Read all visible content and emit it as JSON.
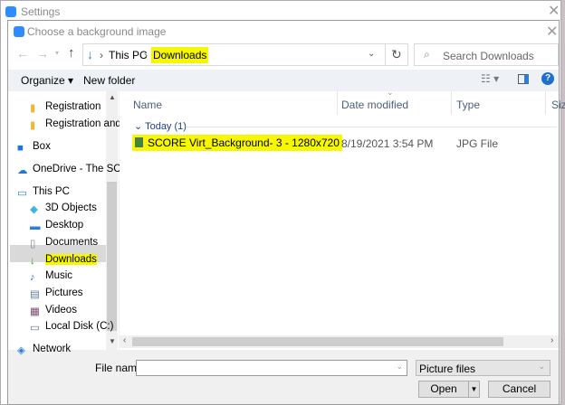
{
  "settings_window": {
    "title": "Settings"
  },
  "dialog": {
    "title": "Choose a background image"
  },
  "address": {
    "crumbs": [
      "This PC",
      "Downloads"
    ],
    "search_placeholder": "Search Downloads"
  },
  "toolbar": {
    "organize": "Organize",
    "new_folder": "New folder"
  },
  "nav": {
    "items": [
      {
        "label": "Registration",
        "icon": "folder-icon"
      },
      {
        "label": "Registration and",
        "icon": "folder-icon"
      },
      {
        "label": "Box",
        "icon": "box-icon"
      },
      {
        "label": "OneDrive - The SC",
        "icon": "onedrive-icon"
      },
      {
        "label": "This PC",
        "icon": "computer-icon"
      },
      {
        "label": "3D Objects",
        "icon": "cube-icon"
      },
      {
        "label": "Desktop",
        "icon": "desktop-icon"
      },
      {
        "label": "Documents",
        "icon": "documents-icon"
      },
      {
        "label": "Downloads",
        "icon": "download-icon",
        "selected": true
      },
      {
        "label": "Music",
        "icon": "music-icon"
      },
      {
        "label": "Pictures",
        "icon": "pictures-icon"
      },
      {
        "label": "Videos",
        "icon": "videos-icon"
      },
      {
        "label": "Local Disk (C:)",
        "icon": "disk-icon"
      },
      {
        "label": "Network",
        "icon": "network-icon"
      }
    ]
  },
  "columns": [
    "Name",
    "Date modified",
    "Type",
    "Size"
  ],
  "group": {
    "label": "Today (1)"
  },
  "files": [
    {
      "name": "SCORE Virt_Background- 3 - 1280x720",
      "date": "8/19/2021 3:54 PM",
      "type": "JPG File"
    }
  ],
  "bottom": {
    "file_name_label": "File name:",
    "file_name_value": "",
    "filter": "Picture files",
    "open": "Open",
    "cancel": "Cancel"
  }
}
